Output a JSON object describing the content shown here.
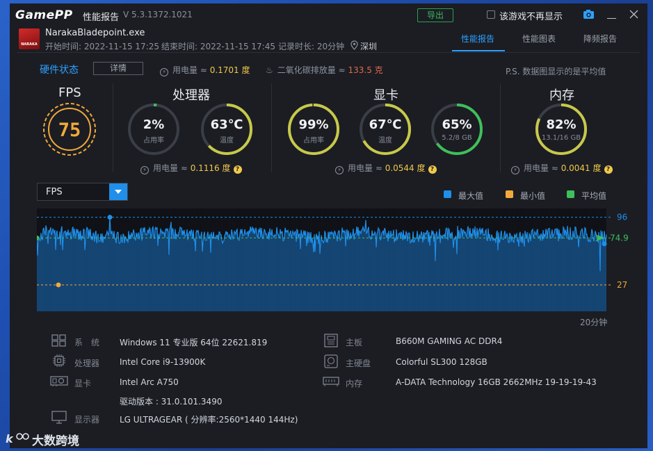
{
  "titlebar": {
    "logo_left": "Game",
    "logo_right": "PP",
    "title": "性能报告",
    "version": "V 5.3.1372.1021",
    "export_label": "导出",
    "hide_label": "该游戏不再显示",
    "camera_icon": "camera-icon",
    "minimize_icon": "minimize-icon",
    "close_icon": "close-icon"
  },
  "app": {
    "name": "NarakaBladepoint.exe",
    "icon_text": "NARAKA",
    "start": "开始时间: 2022-11-15 17:25",
    "end": "结束时间: 2022-11-15 17:45",
    "duration": "记录时长: 20分钟",
    "location": "深圳"
  },
  "tabs": [
    "性能报告",
    "性能图表",
    "降频报告"
  ],
  "status": {
    "title": "硬件状态",
    "detail_label": "详情",
    "power_label": "用电量 ≈",
    "power_value": "0.1701 度",
    "co2_label": "二氧化碳排放量 ≈",
    "co2_value": "133.5 克",
    "note": "P.S. 数据图显示的是平均值"
  },
  "sections": {
    "fps": {
      "title": "FPS",
      "value": "75"
    },
    "cpu": {
      "title": "处理器",
      "usage": {
        "value": "2%",
        "label": "占用率",
        "level": 2
      },
      "temp": {
        "value": "63℃",
        "label": "温度",
        "level": 63
      },
      "power_label": "用电量 ≈",
      "power_value": "0.1116 度"
    },
    "gpu": {
      "title": "显卡",
      "usage": {
        "value": "99%",
        "label": "占用率",
        "level": 99
      },
      "temp": {
        "value": "67℃",
        "label": "温度",
        "level": 67
      },
      "vram": {
        "value": "65%",
        "label": "5.2/8 GB",
        "level": 65
      },
      "power_label": "用电量 ≈",
      "power_value": "0.0544 度"
    },
    "mem": {
      "title": "内存",
      "usage": {
        "value": "82%",
        "label": "13.1/16 GB",
        "level": 82
      },
      "power_label": "用电量 ≈",
      "power_value": "0.0041 度"
    }
  },
  "chart_controls": {
    "select_value": "FPS",
    "legend_max": "最大值",
    "legend_min": "最小值",
    "legend_avg": "平均值"
  },
  "chart_data": {
    "type": "area",
    "title": "",
    "xlabel": "20分钟",
    "ylabel": "",
    "ylim": [
      0,
      105
    ],
    "max": 96,
    "min": 27,
    "avg": 74.9,
    "max_label": "96",
    "min_label": "27",
    "avg_label": "74.9",
    "colors": {
      "max": "#1f8fea",
      "min": "#f2a93b",
      "avg": "#3fbf5a"
    }
  },
  "system": [
    {
      "icon": "windows-icon",
      "label": "系　统",
      "value": "Windows 11 专业版 64位 22621.819"
    },
    {
      "icon": "cpu-icon",
      "label": "处理器",
      "value": "Intel Core i9-13900K"
    },
    {
      "icon": "gpu-icon",
      "label": "显卡",
      "value": "Intel Arc A750",
      "extra": "驱动版本 : 31.0.101.3490"
    },
    {
      "icon": "monitor-icon",
      "label": "显示器",
      "value": "LG ULTRAGEAR ( 分辨率:2560*1440 144Hz)"
    },
    {
      "icon": "motherboard-icon",
      "label": "主板",
      "value": "B660M GAMING AC DDR4"
    },
    {
      "icon": "disk-icon",
      "label": "主硬盘",
      "value": "Colorful SL300 128GB"
    },
    {
      "icon": "memory-icon",
      "label": "内存",
      "value": "A-DATA Technology 16GB 2662MHz 19-19-19-43"
    }
  ],
  "watermark": "大数跨境"
}
